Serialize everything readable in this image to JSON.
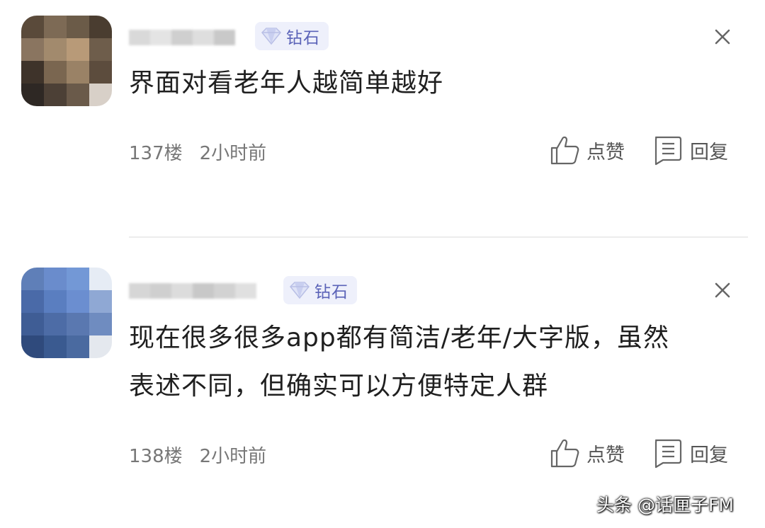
{
  "comments": [
    {
      "badge": "钻石",
      "content": "界面对看老年人越简单越好",
      "floor": "137楼",
      "time": "2小时前",
      "like_label": "点赞",
      "reply_label": "回复"
    },
    {
      "badge": "钻石",
      "content": "现在很多很多app都有简洁/老年/大字版，虽然\n表述不同，但确实可以方便特定人群",
      "floor": "138楼",
      "time": "2小时前",
      "like_label": "点赞",
      "reply_label": "回复"
    }
  ],
  "watermark": "头条 @话匣子FM",
  "colors": {
    "badge_text": "#5b63b8",
    "badge_bg": "#eef0fb",
    "meta_text": "#777777",
    "divider": "#ececec"
  },
  "icons": {
    "badge": "diamond-icon",
    "close": "close-icon",
    "like": "thumbs-up-icon",
    "reply": "comment-icon"
  }
}
